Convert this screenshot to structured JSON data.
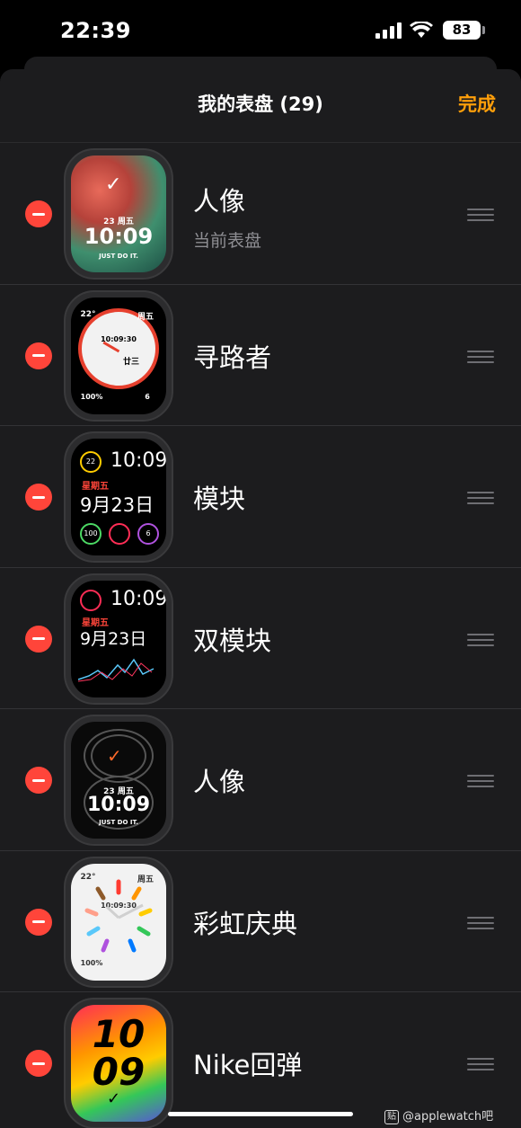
{
  "status": {
    "time": "22:39",
    "battery": "83"
  },
  "header": {
    "title": "我的表盘 (29)",
    "done": "完成"
  },
  "faces": [
    {
      "name": "人像",
      "subtitle": "当前表盘",
      "face": {
        "date": "23 周五",
        "time": "10:09",
        "slogan": "JUST DO IT."
      }
    },
    {
      "name": "寻路者",
      "face": {
        "time": "10:09:30",
        "date": "廿三",
        "temp": "22°",
        "day": "周五",
        "battery": "100%",
        "uv": "6"
      }
    },
    {
      "name": "模块",
      "face": {
        "time": "10:09",
        "weekday": "星期五",
        "date": "9月23日",
        "ring1": "22",
        "ring2": "100",
        "ring3": "6"
      }
    },
    {
      "name": "双模块",
      "face": {
        "time": "10:09",
        "weekday": "星期五",
        "date": "9月23日"
      }
    },
    {
      "name": "人像",
      "face": {
        "date": "23 周五",
        "time": "10:09",
        "slogan": "JUST DO IT."
      }
    },
    {
      "name": "彩虹庆典",
      "face": {
        "time": "10:09:30",
        "temp": "22°",
        "day": "周五",
        "battery": "100%"
      }
    },
    {
      "name": "Nike回弹",
      "face": {
        "hour": "10",
        "minute": "09"
      }
    }
  ],
  "watermark": "@applewatch吧"
}
